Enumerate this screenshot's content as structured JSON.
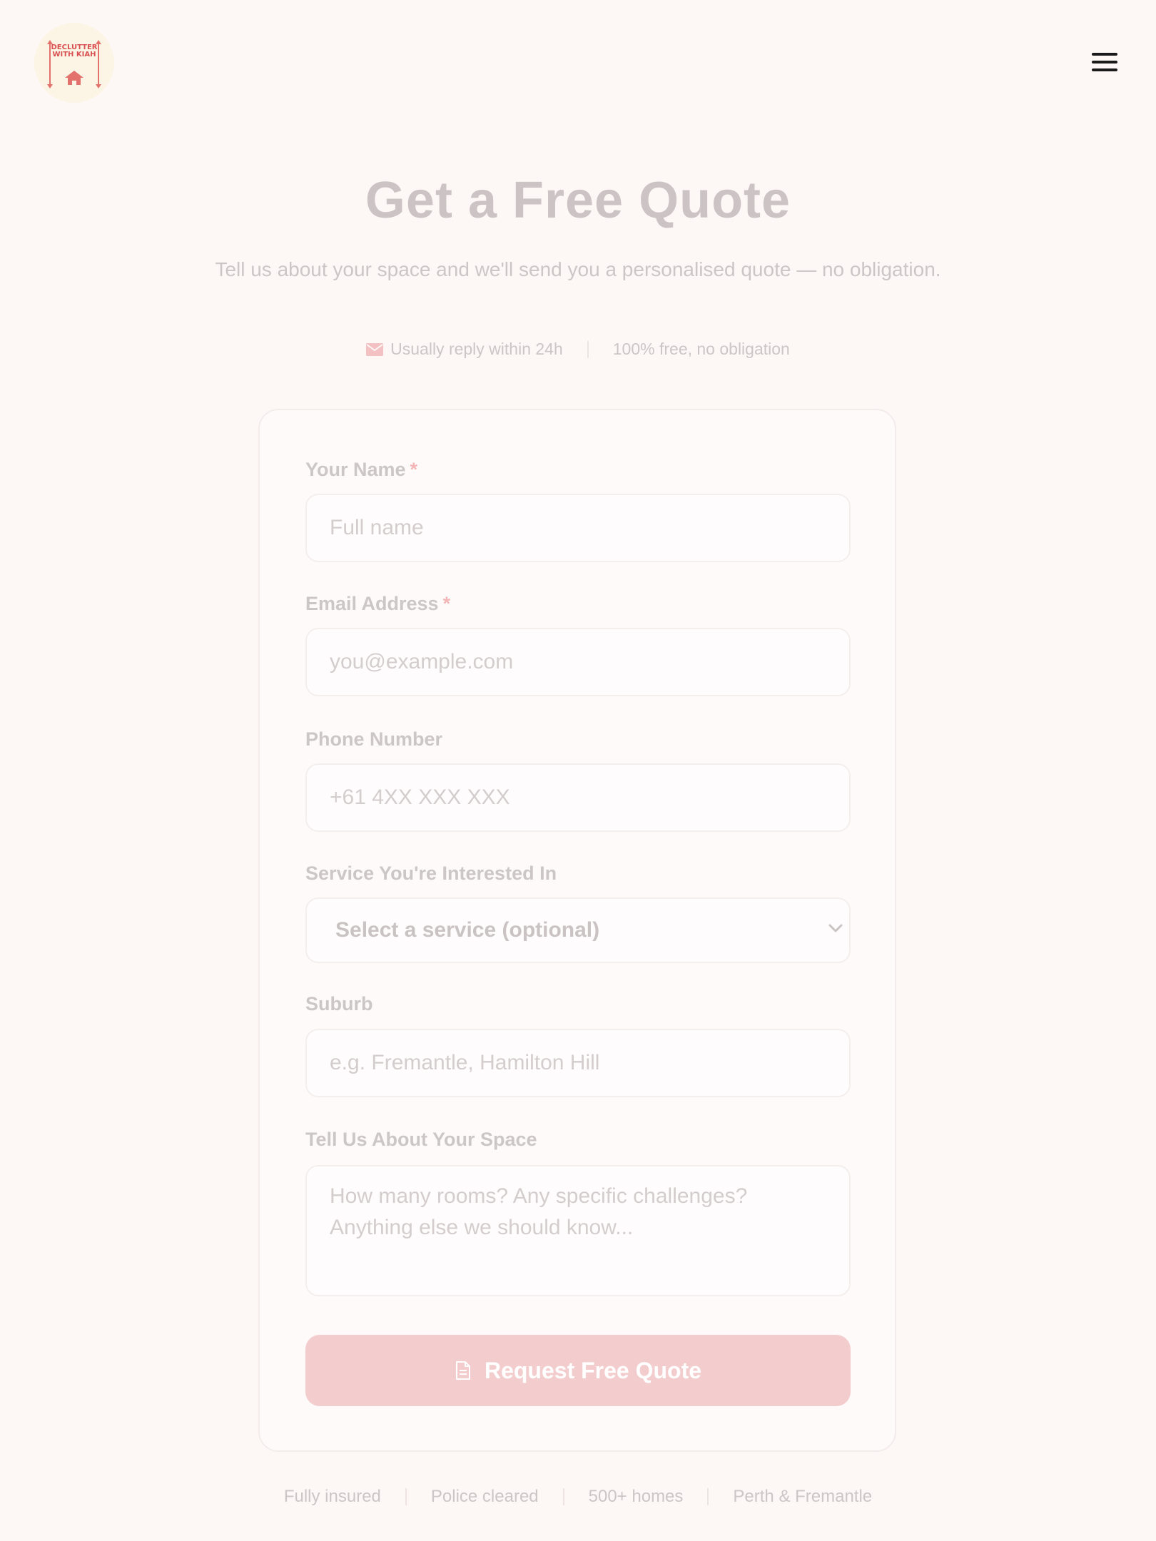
{
  "header": {
    "logo_text": "DECLUTTER WITH KIAH",
    "menu_icon": "hamburger-icon"
  },
  "hero": {
    "title": "Get a Free Quote",
    "subtitle": "Tell us about your space and we'll send you a personalised quote — no obligation.",
    "meta_reply": "Usually reply within 24h",
    "meta_free": "100% free, no obligation"
  },
  "form": {
    "name": {
      "label": "Your Name",
      "required_mark": "*",
      "placeholder": "Full name"
    },
    "email": {
      "label": "Email Address",
      "required_mark": "*",
      "placeholder": "you@example.com"
    },
    "phone": {
      "label": "Phone Number",
      "placeholder": "+61 4XX XXX XXX"
    },
    "service": {
      "label": "Service You're Interested In",
      "selected": "Select a service (optional)"
    },
    "suburb": {
      "label": "Suburb",
      "placeholder": "e.g. Fremantle, Hamilton Hill"
    },
    "space": {
      "label": "Tell Us About Your Space",
      "placeholder": "How many rooms? Any specific challenges? Anything else we should know..."
    },
    "submit_label": "Request Free Quote"
  },
  "footer": {
    "items": [
      "Fully insured",
      "Police cleared",
      "500+ homes",
      "Perth & Fremantle"
    ]
  },
  "colors": {
    "accent": "#e2726b",
    "button": "#f3cdcd",
    "background": "#fdf7f6"
  }
}
